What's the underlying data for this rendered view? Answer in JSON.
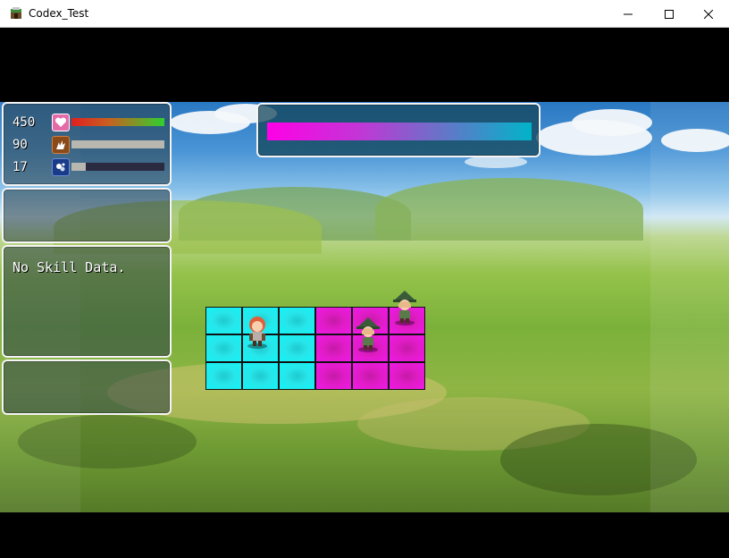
{
  "window": {
    "title": "Codex_Test"
  },
  "status": {
    "hp": {
      "value": "450",
      "fill": 1.0,
      "icon": "heart-icon"
    },
    "tp": {
      "value": "90",
      "fill": 1.0,
      "icon": "burst-icon"
    },
    "mp": {
      "value": "17",
      "fill": 0.15,
      "icon": "mana-icon"
    }
  },
  "skill_window": {
    "text": "No Skill Data."
  },
  "turn_gauge": {
    "fill": 1.0
  },
  "battle_grid": {
    "columns": 6,
    "rows": 3,
    "ally_color": "#14f3f6",
    "enemy_color": "#f019e6"
  },
  "colors": {
    "hp_gradient_start": "#e02020",
    "hp_gradient_end": "#30d030",
    "tp_bar": "#b8b8b0",
    "mp_bar": "#b8b8b0",
    "window_border": "#f4f4f4"
  }
}
